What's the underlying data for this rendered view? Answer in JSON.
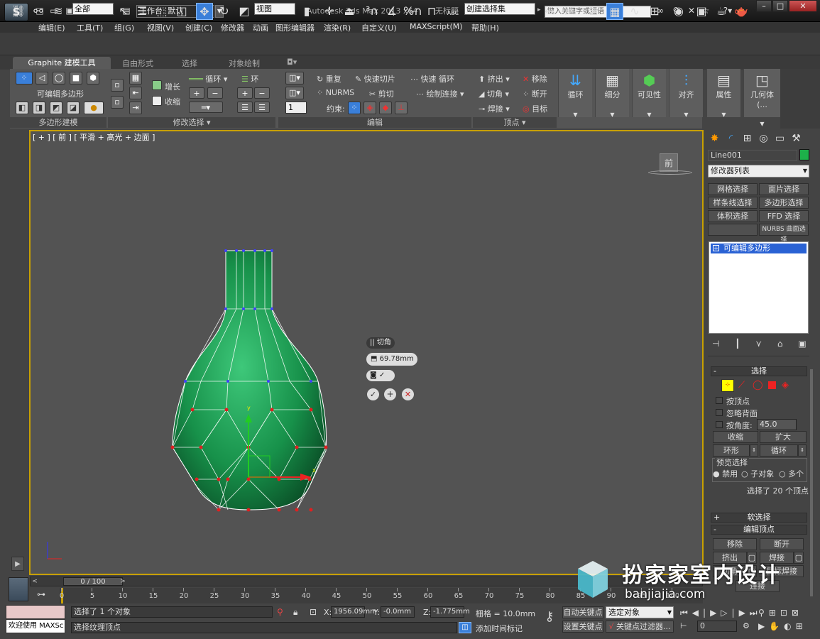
{
  "app": {
    "title": "Autodesk 3ds Max  2013 x64",
    "file": "无标题",
    "workspace": "工作台: 默认",
    "search_placeholder": "键入关键字或短语"
  },
  "menu": [
    "编辑(E)",
    "工具(T)",
    "组(G)",
    "视图(V)",
    "创建(C)",
    "修改器",
    "动画",
    "图形编辑器",
    "渲染(R)",
    "自定义(U)",
    "MAXScript(M)",
    "帮助(H)"
  ],
  "toolbar": {
    "filter": "全部",
    "ref_coord": "视图",
    "selset": "创建选择集",
    "angle_label": "ABC"
  },
  "ribbon": {
    "tabs": [
      "Graphite 建模工具",
      "自由形式",
      "选择",
      "对象绘制"
    ],
    "groups": [
      "多边形建模",
      "修改选择",
      "编辑",
      "顶点"
    ],
    "poly_label": "可编辑多边形",
    "mod_sel": {
      "grow": "增长",
      "shrink": "收缩",
      "loop": "循环",
      "ring": "环"
    },
    "edit": {
      "repeat": "重复",
      "nurms": "NURMS",
      "quickslice": "快速切片",
      "cut": "剪切",
      "quickloop": "快速 循环",
      "drawconnect": "绘制连接",
      "constraints": "约束:",
      "spinner": "1"
    },
    "vertex": {
      "extrude": "挤出",
      "chamfer": "切角",
      "weld": "焊接",
      "remove": "移除",
      "break": "断开",
      "target": "目标"
    },
    "big_buttons": [
      "循环",
      "细分",
      "可见性",
      "对齐",
      "属性",
      "几何体 (..."
    ]
  },
  "viewport": {
    "label": "[ + ] [ 前 ] [ 平滑 + 高光 + 边面 ]",
    "viewcube": "前",
    "caddy_title": "切角",
    "caddy_value": "69.78mm"
  },
  "command_panel": {
    "object_name": "Line001",
    "object_color": "#1db14a",
    "modifier_list": "修改器列表",
    "mod_buttons": [
      "网格选择",
      "面片选择",
      "样条线选择",
      "多边形选择",
      "体积选择",
      "FFD 选择",
      "",
      "NURBS 曲面选择"
    ],
    "stack_item": "可编辑多边形",
    "selection_rollout": "选择",
    "by_vertex": "按顶点",
    "ignore_back": "忽略背面",
    "by_angle": "按角度:",
    "angle_value": "45.0",
    "shrink": "收缩",
    "grow": "扩大",
    "ring": "环形",
    "loop": "循环",
    "preview_title": "预览选择",
    "preview_opts": [
      "禁用",
      "子对象",
      "多个"
    ],
    "sel_count": "选择了 20 个顶点",
    "soft_sel": "软选择",
    "edit_vert": "编辑顶点",
    "remove": "移除",
    "break": "断开",
    "extrude": "挤出",
    "weld": "焊接",
    "chamfer": "切角",
    "target_weld": "目标焊接",
    "connect": "连接"
  },
  "timeline": {
    "frame": "0 / 100",
    "ticks": [
      "0",
      "5",
      "10",
      "15",
      "20",
      "25",
      "30",
      "35",
      "40",
      "45",
      "50",
      "55",
      "60",
      "65",
      "70",
      "75",
      "80",
      "85",
      "90",
      "95",
      "100"
    ]
  },
  "status": {
    "welcome": "欢迎使用 MAXSc",
    "selected": "选择了 1 个对象",
    "prompt": "选择纹理顶点",
    "x": "1956.09mm",
    "y": "-0.0mm",
    "z": "-1.775mm",
    "grid": "栅格 = 10.0mm",
    "add_tag": "添加时间标记",
    "auto_key": "自动关键点",
    "set_key": "设置关键点",
    "sel_obj": "选定对象",
    "key_filter": "关键点过滤器...",
    "frame_field": "0"
  },
  "watermark": {
    "cn": "扮家家室内设计",
    "url": "banjiajia.com"
  }
}
